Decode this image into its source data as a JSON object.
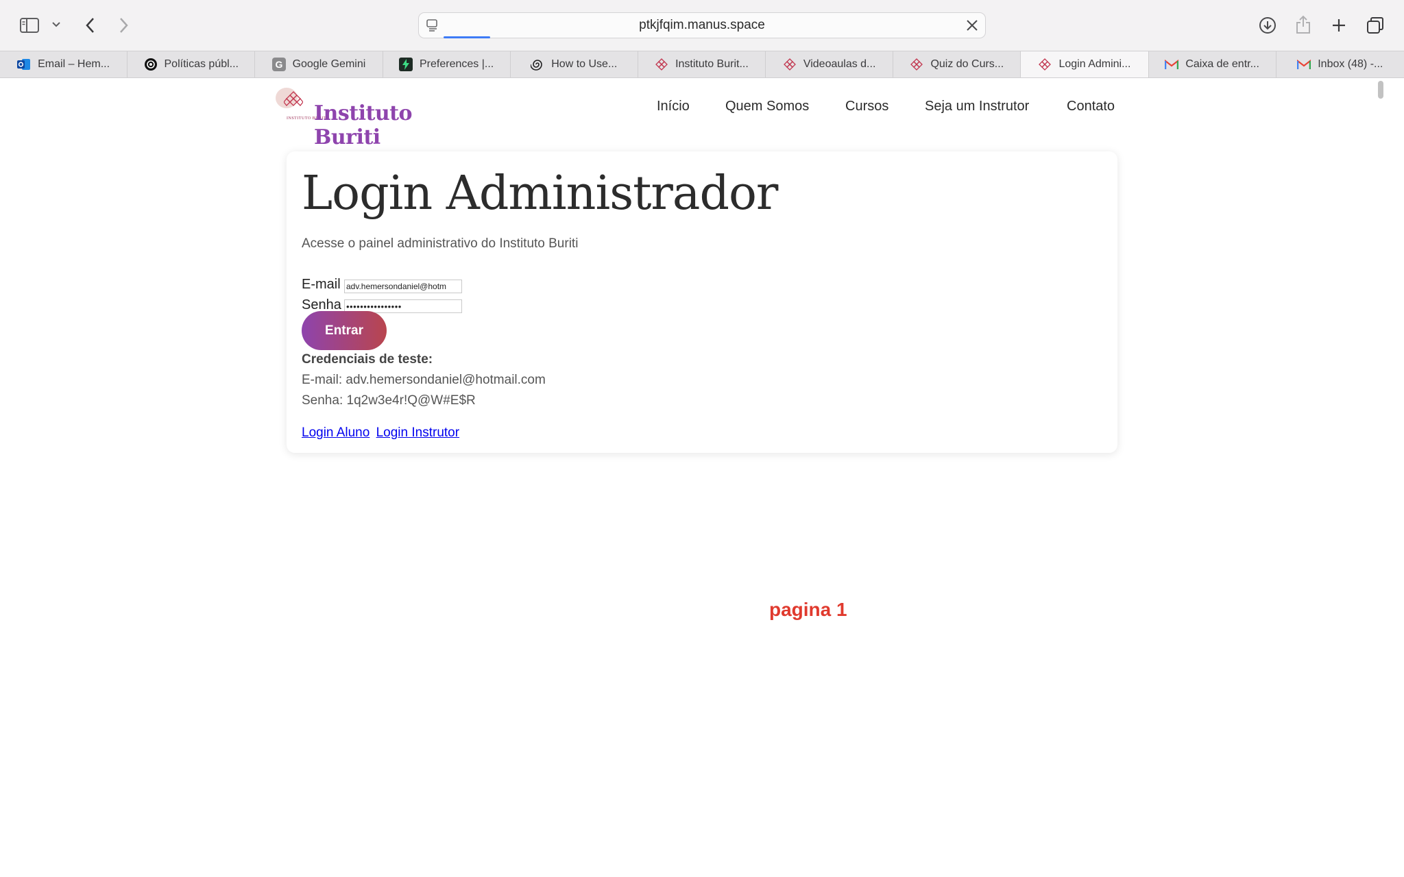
{
  "browser": {
    "url": "ptkjfqim.manus.space",
    "tabs": [
      {
        "label": "Email – Hem...",
        "icon": "outlook-icon"
      },
      {
        "label": "Políticas públ...",
        "icon": "openai-icon"
      },
      {
        "label": "Google Gemini",
        "icon": "g-letter-icon"
      },
      {
        "label": "Preferences |...",
        "icon": "bolt-icon"
      },
      {
        "label": "How to Use...",
        "icon": "spiral-icon"
      },
      {
        "label": "Instituto Burit...",
        "icon": "buriti-icon"
      },
      {
        "label": "Videoaulas d...",
        "icon": "buriti-icon"
      },
      {
        "label": "Quiz do Curs...",
        "icon": "buriti-icon"
      },
      {
        "label": "Login Admini...",
        "icon": "buriti-icon",
        "active": true
      },
      {
        "label": "Caixa de entr...",
        "icon": "gmail-icon"
      },
      {
        "label": "Inbox (48) -...",
        "icon": "gmail-icon"
      }
    ]
  },
  "site": {
    "logo_text": "Instituto Buriti",
    "logo_tag": "INSTITUTO BURITI",
    "nav": [
      "Início",
      "Quem Somos",
      "Cursos",
      "Seja um Instrutor",
      "Contato"
    ]
  },
  "login": {
    "title": "Login Administrador",
    "subtitle": "Acesse o painel administrativo do Instituto Buriti",
    "email_label": "E-mail",
    "email_value": "adv.hemersondaniel@hotm",
    "password_label": "Senha",
    "password_value": "••••••••••••••••",
    "submit_label": "Entrar",
    "creds_heading": "Credenciais de teste:",
    "creds_email": "E-mail: adv.hemersondaniel@hotmail.com",
    "creds_password": "Senha: 1q2w3e4r!Q@W#E$R",
    "link_student": "Login Aluno",
    "link_instructor": "Login Instrutor"
  },
  "page_marker": "pagina 1",
  "colors": {
    "brand_purple": "#8e44ad",
    "brand_red": "#b9454e",
    "page_marker": "#e03a2e",
    "link": "#0000ee"
  }
}
